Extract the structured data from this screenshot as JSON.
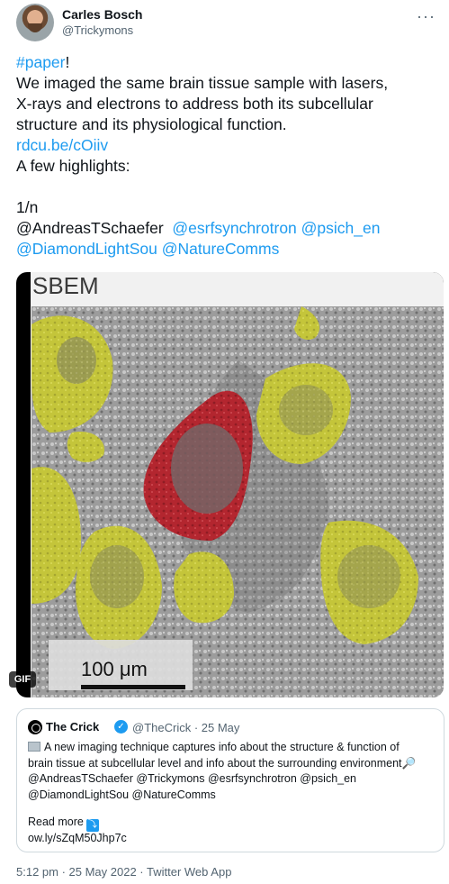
{
  "author": {
    "name": "Carles Bosch",
    "handle": "@Trickymons"
  },
  "menu_icon": "more-horizontal-icon",
  "tweet": {
    "hashtag": "#paper",
    "hashtag_suffix": "!",
    "lines": [
      "We imaged the same brain tissue sample with lasers,",
      "X-rays and electrons to address both its subcellular",
      "structure and its physiological function."
    ],
    "link": "rdcu.be/cOiiv",
    "highlights": "A few highlights:",
    "thread_index": "1/n",
    "mentions_line1_plain": "@AndreasTSchaefer",
    "mentions_line1_links": "@esrfsynchrotron @psich_en",
    "mentions_line2_links": "@DiamondLightSou @NatureComms"
  },
  "media": {
    "label": "SBEM",
    "scale_label": "100 μm",
    "badge": "GIF",
    "colors": {
      "cells": "#c7c83a",
      "highlight": "#b3262f"
    }
  },
  "quote": {
    "name": "The Crick",
    "handle": "@TheCrick",
    "date": "25 May",
    "body_lines": [
      "A new imaging technique captures info about the structure & function of",
      "brain tissue at subcellular level and info about the surrounding environment",
      "@AndreasTSchaefer @Trickymons @esrfsynchrotron @psich_en",
      "@DiamondLightSou @NatureComms"
    ],
    "read_more": "Read more",
    "url": "ow.ly/sZqM50Jhp7c"
  },
  "footer": "5:12 pm · 25 May 2022 · Twitter Web App"
}
